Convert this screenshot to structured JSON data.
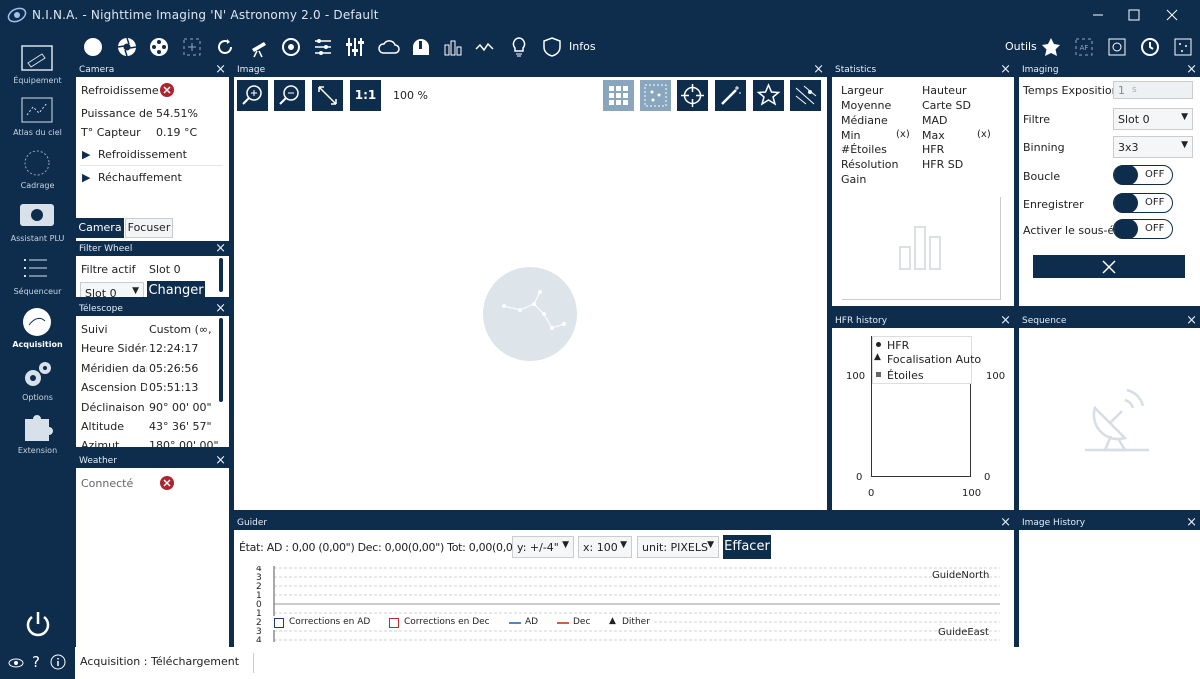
{
  "window": {
    "title": "N.I.N.A. - Nighttime Imaging 'N' Astronomy 2.0  -  Default"
  },
  "toolbar": {
    "infos_label": "Infos",
    "outils_label": "Outils"
  },
  "nav": {
    "items": [
      {
        "label": "Équipement"
      },
      {
        "label": "Atlas du ciel"
      },
      {
        "label": "Cadrage"
      },
      {
        "label": "Assistant PLU"
      },
      {
        "label": "Séquenceur"
      },
      {
        "label": "Acquisition"
      },
      {
        "label": "Options"
      },
      {
        "label": "Extension"
      }
    ]
  },
  "camera": {
    "title": "Camera",
    "rows": [
      {
        "label": "Refroidissemer",
        "value": ""
      },
      {
        "label": "Puissance de R",
        "value": "54.51%"
      },
      {
        "label": "T° Capteur",
        "value": "0.19 °C"
      }
    ],
    "expanders": [
      "Refroidissement",
      "Réchauffement"
    ],
    "tabs": [
      "Camera",
      "Focuser"
    ]
  },
  "filterwheel": {
    "title": "Filter Wheel",
    "active_label": "Filtre actif",
    "active_value": "Slot 0",
    "select_value": "Slot 0",
    "change_label": "Changer"
  },
  "telescope": {
    "title": "Télescope",
    "rows": [
      {
        "label": "Suivi",
        "value": "Custom (∞,"
      },
      {
        "label": "Heure Sidéra",
        "value": "12:24:17"
      },
      {
        "label": "Méridien dar",
        "value": "05:26:56"
      },
      {
        "label": "Ascension Dr",
        "value": "05:51:13"
      },
      {
        "label": "Déclinaison",
        "value": "90° 00' 00\""
      },
      {
        "label": "Altitude",
        "value": "43° 36' 57\""
      },
      {
        "label": "Azimut",
        "value": "180° 00' 00\""
      }
    ]
  },
  "weather": {
    "title": "Weather",
    "connected_label": "Connecté"
  },
  "image": {
    "title": "Image",
    "zoom_1to1": "1:1",
    "zoom_percent": "100 %"
  },
  "statistics": {
    "title": "Statistics",
    "left": [
      "Largeur",
      "Moyenne",
      "Médiane",
      "Min",
      "#Étoiles",
      "Résolution",
      "Gain"
    ],
    "left_suffix": [
      "",
      "",
      "",
      "(x)",
      "",
      "",
      ""
    ],
    "right": [
      "Hauteur",
      "Carte SD",
      "MAD",
      "Max",
      "HFR",
      "HFR SD"
    ],
    "right_suffix": [
      "",
      "",
      "",
      "(x)",
      "",
      ""
    ]
  },
  "imaging": {
    "title": "Imaging",
    "exposure_label": "Temps Exposition",
    "exposure_value": "1",
    "exposure_unit": "s",
    "filter_label": "Filtre",
    "filter_value": "Slot 0",
    "binning_label": "Binning",
    "binning_value": "3x3",
    "loop_label": "Boucle",
    "save_label": "Enregistrer",
    "subsample_label": "Activer le sous-éc",
    "toggle_off": "OFF"
  },
  "hfr": {
    "title": "HFR history",
    "legend": [
      "HFR",
      "Focalisation Auto",
      "Étoiles"
    ],
    "y_top_left": "100",
    "y_top_right": "100",
    "y_bottom_left": "0",
    "y_bottom_right": "0",
    "x_left": "0",
    "x_right": "100"
  },
  "sequence": {
    "title": "Sequence"
  },
  "guider": {
    "title": "Guider",
    "state": "État:  AD : 0,00 (0,00\")  Dec: 0,00(0,00\")  Tot: 0,00(0,00\")",
    "y_select": "y: +/-4\"",
    "x_select": "x: 100",
    "unit_select": "unit: PIXELS",
    "clear_label": "Effacer",
    "y_ticks": [
      "4",
      "3",
      "2",
      "1",
      "0",
      "1",
      "2",
      "3",
      "4"
    ],
    "north_label": "GuideNorth",
    "east_label": "GuideEast",
    "legend": [
      "Corrections en AD",
      "Corrections en Dec",
      "AD",
      "Dec",
      "Dither"
    ],
    "colors": {
      "ra": "#4e86c4",
      "dec": "#d45f3a",
      "ra_box": "#1c3f7a",
      "dec_box": "#c2282a"
    }
  },
  "image_history": {
    "title": "Image History"
  },
  "status": {
    "label": "Acquisition :",
    "value": "Téléchargement"
  }
}
